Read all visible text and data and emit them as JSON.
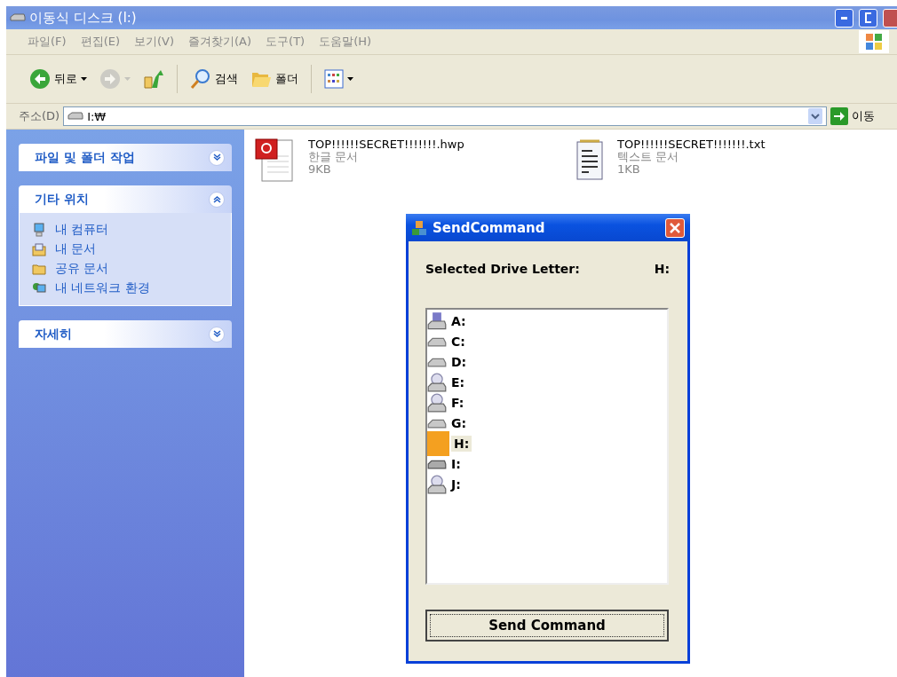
{
  "window": {
    "title": "이동식 디스크 (I:)"
  },
  "menu": [
    "파일(F)",
    "편집(E)",
    "보기(V)",
    "즐겨찾기(A)",
    "도구(T)",
    "도움말(H)"
  ],
  "toolbar": [
    {
      "kind": "back",
      "label": "뒤로",
      "disabled": false
    },
    {
      "kind": "forward",
      "disabled": true
    },
    {
      "kind": "up",
      "disabled": false
    },
    {
      "kind": "search",
      "label": "검색",
      "disabled": false
    },
    {
      "kind": "folders",
      "label": "폴더",
      "disabled": false
    },
    {
      "kind": "views",
      "disabled": false
    }
  ],
  "address": {
    "label": "주소(D)",
    "value": "I:₩",
    "go": "이동"
  },
  "sidebar": [
    {
      "title": "파일 및 폴더 작업",
      "expanded": false
    },
    {
      "title": "기타 위치",
      "expanded": true,
      "items": [
        {
          "kind": "computer",
          "label": "내 컴퓨터"
        },
        {
          "kind": "documents",
          "label": "내 문서"
        },
        {
          "kind": "folder",
          "label": "공유 문서"
        },
        {
          "kind": "network",
          "label": "내 네트워크 환경"
        }
      ]
    },
    {
      "title": "자세히",
      "expanded": false
    }
  ],
  "files": [
    {
      "kind": "hwp",
      "name": "TOP!!!!!!SECRET!!!!!!!.hwp",
      "type": "한글 문서",
      "size": "9KB"
    },
    {
      "kind": "txt",
      "name": "TOP!!!!!!SECRET!!!!!!!.txt",
      "type": "텍스트 문서",
      "size": "1KB"
    }
  ],
  "dialog": {
    "title": "SendCommand",
    "label": "Selected Drive Letter:",
    "value": "H:",
    "drives": [
      {
        "kind": "floppy",
        "letter": "A:",
        "selected": false
      },
      {
        "kind": "disk",
        "letter": "C:",
        "selected": false
      },
      {
        "kind": "disk",
        "letter": "D:",
        "selected": false
      },
      {
        "kind": "cd",
        "letter": "E:",
        "selected": false
      },
      {
        "kind": "cd",
        "letter": "F:",
        "selected": false
      },
      {
        "kind": "disk",
        "letter": "G:",
        "selected": false
      },
      {
        "kind": "unknown",
        "letter": "H:",
        "selected": true
      },
      {
        "kind": "removable",
        "letter": "I:",
        "selected": false
      },
      {
        "kind": "cd",
        "letter": "J:",
        "selected": false
      }
    ],
    "button": "Send Command"
  }
}
